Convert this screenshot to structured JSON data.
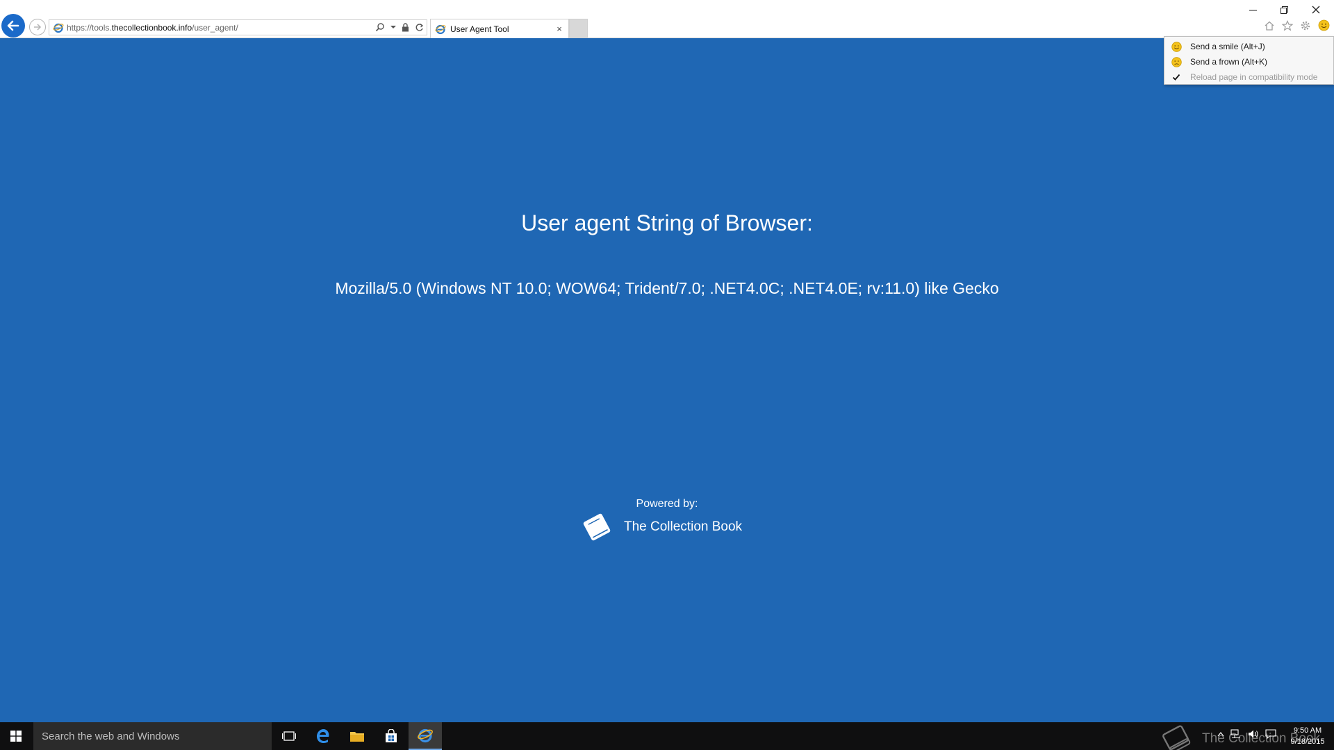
{
  "browser": {
    "url_prefix": "https://tools.",
    "url_domain": "thecollectionbook.info",
    "url_path": "/user_agent/",
    "tab_title": "User Agent Tool",
    "tab_close": "×"
  },
  "feedback_menu": {
    "items": [
      {
        "label": "Send a smile (Alt+J)",
        "icon": "smile-icon",
        "disabled": false
      },
      {
        "label": "Send a frown (Alt+K)",
        "icon": "frown-icon",
        "disabled": false
      },
      {
        "label": "Reload page in compatibility mode",
        "icon": "checkmark-icon",
        "disabled": true
      }
    ]
  },
  "page": {
    "heading": "User agent String of Browser:",
    "user_agent": "Mozilla/5.0 (Windows NT 10.0; WOW64; Trident/7.0; .NET4.0C; .NET4.0E; rv:11.0) like Gecko",
    "powered_by": "Powered by:",
    "brand_name": "The Collection Book",
    "background_color": "#1f67b4"
  },
  "taskbar": {
    "search_placeholder": "Search the web and Windows",
    "watermark": "The Collection Book",
    "time": "9:50 AM",
    "date": "9/18/2015"
  }
}
